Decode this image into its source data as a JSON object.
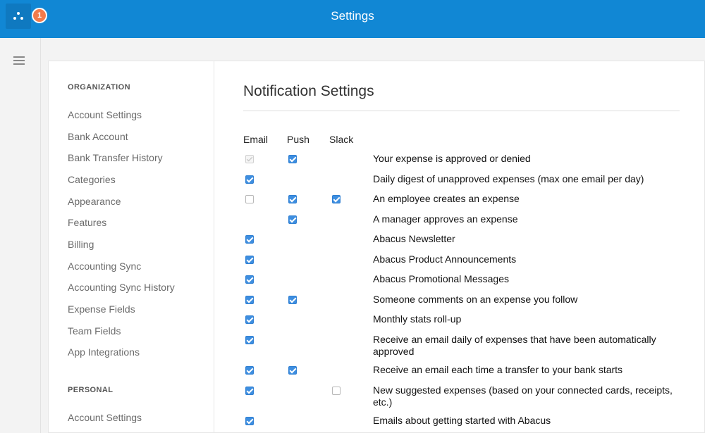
{
  "header": {
    "title": "Settings",
    "notification_count": "1",
    "accent_color": "#1187d4"
  },
  "sidebar": {
    "organization_label": "ORGANIZATION",
    "organization_items": [
      "Account Settings",
      "Bank Account",
      "Bank Transfer History",
      "Categories",
      "Appearance",
      "Features",
      "Billing",
      "Accounting Sync",
      "Accounting Sync History",
      "Expense Fields",
      "Team Fields",
      "App Integrations"
    ],
    "personal_label": "PERSONAL",
    "personal_items": [
      "Account Settings"
    ]
  },
  "main": {
    "title": "Notification Settings",
    "columns": {
      "email": "Email",
      "push": "Push",
      "slack": "Slack"
    },
    "rows": [
      {
        "label": "Your expense is approved or denied",
        "email": "checked-disabled",
        "push": "checked",
        "slack": "none"
      },
      {
        "label": "Daily digest of unapproved expenses (max one email per day)",
        "email": "checked",
        "push": "none",
        "slack": "none"
      },
      {
        "label": "An employee creates an expense",
        "email": "unchecked",
        "push": "checked",
        "slack": "checked"
      },
      {
        "label": "A manager approves an expense",
        "email": "none",
        "push": "checked",
        "slack": "none"
      },
      {
        "label": "Abacus Newsletter",
        "email": "checked",
        "push": "none",
        "slack": "none"
      },
      {
        "label": "Abacus Product Announcements",
        "email": "checked",
        "push": "none",
        "slack": "none"
      },
      {
        "label": "Abacus Promotional Messages",
        "email": "checked",
        "push": "none",
        "slack": "none"
      },
      {
        "label": "Someone comments on an expense you follow",
        "email": "checked",
        "push": "checked",
        "slack": "none"
      },
      {
        "label": "Monthly stats roll-up",
        "email": "checked",
        "push": "none",
        "slack": "none"
      },
      {
        "label": "Receive an email daily of expenses that have been automatically approved",
        "email": "checked",
        "push": "none",
        "slack": "none"
      },
      {
        "label": "Receive an email each time a transfer to your bank starts",
        "email": "checked",
        "push": "checked",
        "slack": "none"
      },
      {
        "label": "New suggested expenses (based on your connected cards, receipts, etc.)",
        "email": "checked",
        "push": "none",
        "slack": "unchecked"
      },
      {
        "label": "Emails about getting started with Abacus",
        "email": "checked",
        "push": "none",
        "slack": "none"
      }
    ]
  }
}
